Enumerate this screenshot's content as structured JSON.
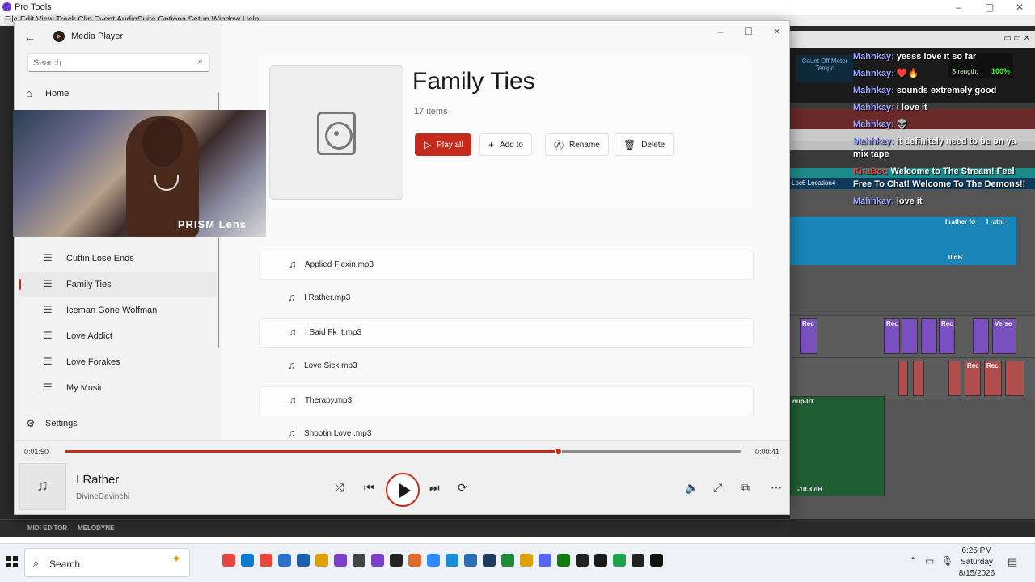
{
  "protools": {
    "title": "Pro Tools",
    "menu": "File  Edit  View  Track  Clip  Event  AudioSuite  Options  Setup  Window  Help",
    "counter": "Count Off\nMeter\nTempo",
    "grid_label": "Strength:",
    "grid_value": "100%",
    "markers": "Loc6  Location4",
    "bottom_left": "MIDI EDITOR",
    "bottom_right": "MELODYNE",
    "clip_label_rec": "Rec",
    "clip_label_verse": "Verse",
    "clip_label_group": "oup-01",
    "clip_db_1": "0 dB",
    "clip_db_2": "-10.3 dB",
    "clip_rather": "I rather fo",
    "clip_rathi": "I rathi"
  },
  "chat": [
    {
      "user": "Mahhkay:",
      "text": "yesss love it so far",
      "red": false
    },
    {
      "user": "Mahhkay:",
      "text": "❤️🔥",
      "red": false
    },
    {
      "user": "Mahhkay:",
      "text": "sounds extremely good",
      "red": false
    },
    {
      "user": "Mahhkay:",
      "text": "i love it",
      "red": false
    },
    {
      "user": "Mahhkay:",
      "text": "👽",
      "red": false
    },
    {
      "user": "Mahhkay:",
      "text": "it definitely need to be on ya mix tape",
      "red": false
    },
    {
      "user": "KiraBot:",
      "text": "Welcome to The Stream! Feel Free To Chat! Welcome To The Demons!!",
      "red": true
    },
    {
      "user": "Mahhkay:",
      "text": "love it",
      "red": false
    }
  ],
  "app": {
    "title": "Media Player",
    "search_placeholder": "Search",
    "nav_home": "Home",
    "settings": "Settings",
    "webcam_label": "PRISM Lens"
  },
  "playlists": [
    {
      "name": "Cuttin Lose Ends",
      "active": false
    },
    {
      "name": "Family Ties",
      "active": true
    },
    {
      "name": "Iceman Gone Wolfman",
      "active": false
    },
    {
      "name": "Love Addict",
      "active": false
    },
    {
      "name": "Love Forakes",
      "active": false
    },
    {
      "name": "My Music",
      "active": false
    }
  ],
  "header": {
    "title": "Family Ties",
    "count": "17 items",
    "play_all": "Play all",
    "add_to": "Add to",
    "rename": "Rename",
    "delete": "Delete"
  },
  "tracks": [
    "Applied Flexin.mp3",
    "I Rather.mp3",
    "I Said Fk It.mp3",
    "Love Sick.mp3",
    "Therapy.mp3",
    "Shootin Love .mp3"
  ],
  "player": {
    "elapsed": "0:01:50",
    "remaining": "0:00:41",
    "progress": 0.73,
    "title": "I Rather",
    "artist": "DivineDavinchi",
    "accent": "#c42b1c"
  },
  "taskbar": {
    "search_label": "Search",
    "time": "6:25 PM",
    "day": "Saturday",
    "date": "8/15/2026"
  }
}
